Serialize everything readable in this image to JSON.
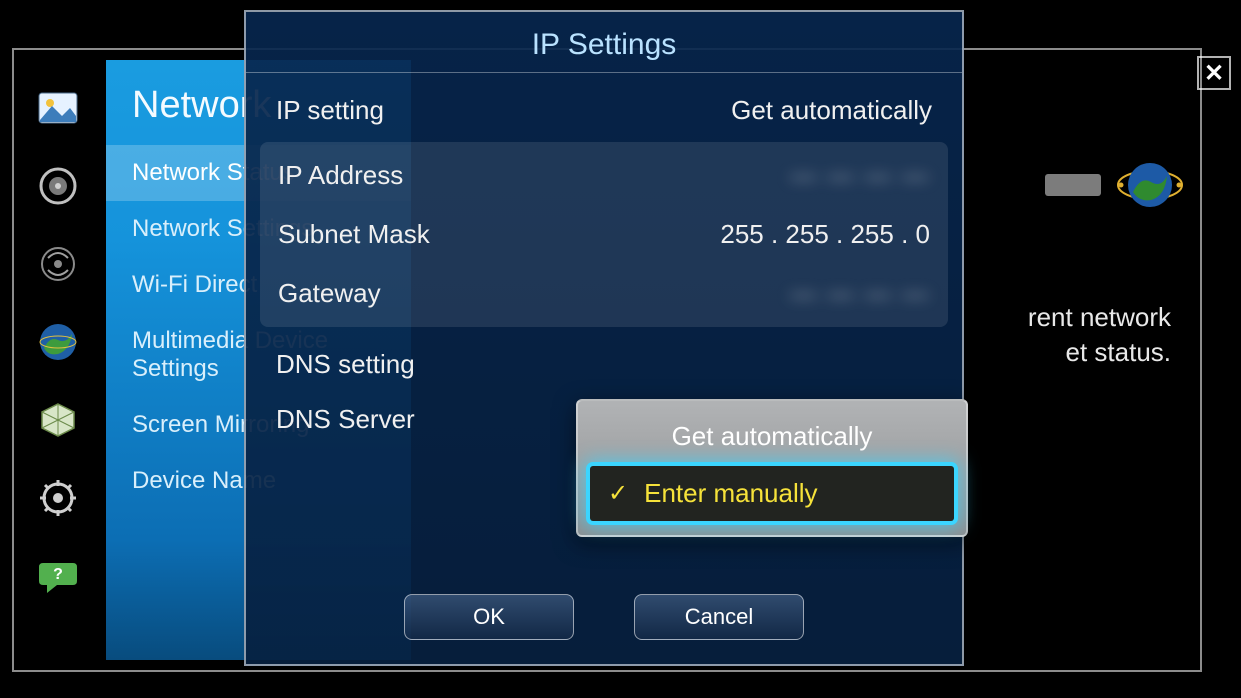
{
  "sidebar": {
    "title": "Network",
    "items": [
      {
        "label": "Network Status"
      },
      {
        "label": "Network Settings"
      },
      {
        "label": "Wi-Fi Direct"
      },
      {
        "label": "Multimedia Device Settings"
      },
      {
        "label": "Screen Mirroring"
      },
      {
        "label": "Device Name"
      }
    ]
  },
  "right_text": {
    "line1": "rent network",
    "line2": "et status."
  },
  "modal": {
    "title": "IP Settings",
    "ip_setting_label": "IP setting",
    "ip_setting_value": "Get automatically",
    "ip_address_label": "IP Address",
    "ip_address_value": "— — — —",
    "subnet_label": "Subnet Mask",
    "subnet_value": "255 . 255 . 255 . 0",
    "gateway_label": "Gateway",
    "gateway_value": "— — — —",
    "dns_setting_label": "DNS setting",
    "dns_server_label": "DNS Server",
    "ok_label": "OK",
    "cancel_label": "Cancel"
  },
  "dropdown": {
    "option_auto": "Get automatically",
    "option_manual": "Enter manually"
  }
}
